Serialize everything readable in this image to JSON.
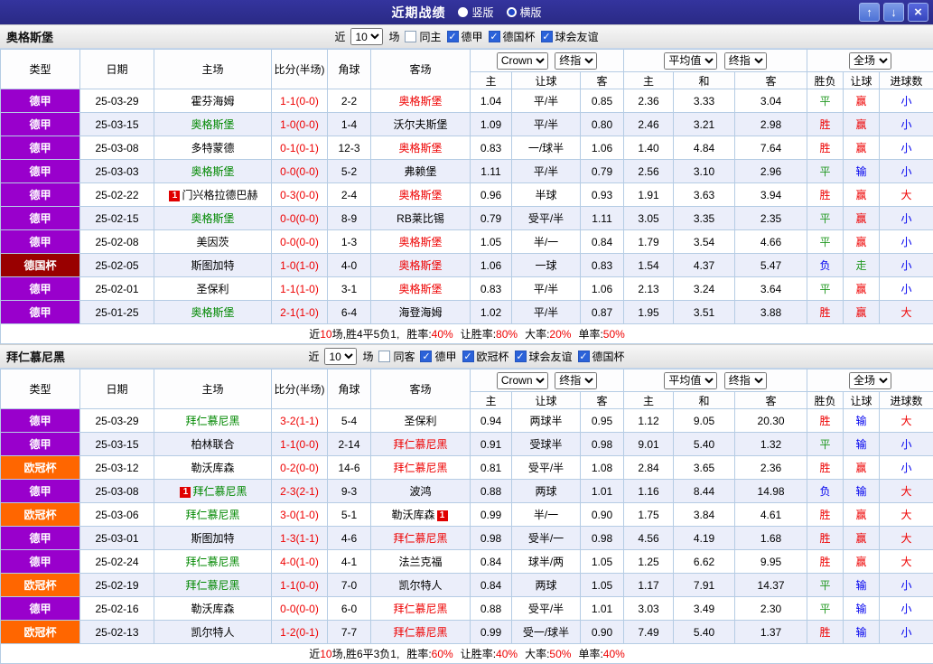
{
  "titlebar": {
    "title": "近期战绩",
    "view_options": [
      {
        "label": "竖版",
        "selected": false
      },
      {
        "label": "横版",
        "selected": true
      }
    ],
    "up_icon": "↑",
    "down_icon": "↓",
    "close_icon": "×"
  },
  "columns": {
    "type": "类型",
    "date": "日期",
    "home": "主场",
    "score": "比分(半场)",
    "corner": "角球",
    "away": "客场",
    "odds_home": "主",
    "odds_line": "让球",
    "odds_away": "客",
    "ep_home": "主",
    "ep_draw": "和",
    "ep_away": "客",
    "result": "胜负",
    "handicap_result": "让球",
    "goals": "进球数"
  },
  "controls": {
    "company": "Crown",
    "final_index": "终指",
    "average": "平均值",
    "final_index2": "终指",
    "full_match": "全场"
  },
  "sections": [
    {
      "team": "奥格斯堡",
      "filter": {
        "recent_label": "近",
        "count": "10",
        "games_label": "场",
        "same_label": "同主",
        "same_checked": false,
        "leagues": [
          {
            "label": "德甲",
            "checked": true
          },
          {
            "label": "德国杯",
            "checked": true
          },
          {
            "label": "球会友谊",
            "checked": true
          }
        ]
      },
      "rows": [
        {
          "league": "德甲",
          "date": "25-03-29",
          "home": "霍芬海姆",
          "score": "1-1(0-0)",
          "corner": "2-2",
          "away": "奥格斯堡",
          "w_home": "1.04",
          "line": "平/半",
          "w_away": "0.85",
          "e_home": "2.36",
          "e_draw": "3.33",
          "e_away": "3.04",
          "result": "平",
          "line_result": "赢",
          "goal_result": "小"
        },
        {
          "league": "德甲",
          "date": "25-03-15",
          "home": "奥格斯堡",
          "score": "1-0(0-0)",
          "corner": "1-4",
          "away": "沃尔夫斯堡",
          "w_home": "1.09",
          "line": "平/半",
          "w_away": "0.80",
          "e_home": "2.46",
          "e_draw": "3.21",
          "e_away": "2.98",
          "result": "胜",
          "line_result": "赢",
          "goal_result": "小"
        },
        {
          "league": "德甲",
          "date": "25-03-08",
          "home": "多特蒙德",
          "score": "0-1(0-1)",
          "corner": "12-3",
          "away": "奥格斯堡",
          "w_home": "0.83",
          "line": "一/球半",
          "w_away": "1.06",
          "e_home": "1.40",
          "e_draw": "4.84",
          "e_away": "7.64",
          "result": "胜",
          "line_result": "赢",
          "goal_result": "小"
        },
        {
          "league": "德甲",
          "date": "25-03-03",
          "home": "奥格斯堡",
          "score": "0-0(0-0)",
          "corner": "5-2",
          "away": "弗赖堡",
          "w_home": "1.11",
          "line": "平/半",
          "w_away": "0.79",
          "e_home": "2.56",
          "e_draw": "3.10",
          "e_away": "2.96",
          "result": "平",
          "line_result": "输",
          "goal_result": "小"
        },
        {
          "league": "德甲",
          "date": "25-02-22",
          "home": "门兴格拉德巴赫",
          "home_card": "1",
          "score": "0-3(0-0)",
          "corner": "2-4",
          "away": "奥格斯堡",
          "w_home": "0.96",
          "line": "半球",
          "w_away": "0.93",
          "e_home": "1.91",
          "e_draw": "3.63",
          "e_away": "3.94",
          "result": "胜",
          "line_result": "赢",
          "goal_result": "大"
        },
        {
          "league": "德甲",
          "date": "25-02-15",
          "home": "奥格斯堡",
          "score": "0-0(0-0)",
          "corner": "8-9",
          "away": "RB莱比锡",
          "w_home": "0.79",
          "line": "受平/半",
          "w_away": "1.11",
          "e_home": "3.05",
          "e_draw": "3.35",
          "e_away": "2.35",
          "result": "平",
          "line_result": "赢",
          "goal_result": "小"
        },
        {
          "league": "德甲",
          "date": "25-02-08",
          "home": "美因茨",
          "score": "0-0(0-0)",
          "corner": "1-3",
          "away": "奥格斯堡",
          "w_home": "1.05",
          "line": "半/一",
          "w_away": "0.84",
          "e_home": "1.79",
          "e_draw": "3.54",
          "e_away": "4.66",
          "result": "平",
          "line_result": "赢",
          "goal_result": "小"
        },
        {
          "league": "德国杯",
          "date": "25-02-05",
          "home": "斯图加特",
          "score": "1-0(1-0)",
          "corner": "4-0",
          "away": "奥格斯堡",
          "w_home": "1.06",
          "line": "一球",
          "w_away": "0.83",
          "e_home": "1.54",
          "e_draw": "4.37",
          "e_away": "5.47",
          "result": "负",
          "line_result": "走",
          "goal_result": "小"
        },
        {
          "league": "德甲",
          "date": "25-02-01",
          "home": "圣保利",
          "score": "1-1(1-0)",
          "corner": "3-1",
          "away": "奥格斯堡",
          "w_home": "0.83",
          "line": "平/半",
          "w_away": "1.06",
          "e_home": "2.13",
          "e_draw": "3.24",
          "e_away": "3.64",
          "result": "平",
          "line_result": "赢",
          "goal_result": "小"
        },
        {
          "league": "德甲",
          "date": "25-01-25",
          "home": "奥格斯堡",
          "score": "2-1(1-0)",
          "corner": "6-4",
          "away": "海登海姆",
          "w_home": "1.02",
          "line": "平/半",
          "w_away": "0.87",
          "e_home": "1.95",
          "e_draw": "3.51",
          "e_away": "3.88",
          "result": "胜",
          "line_result": "赢",
          "goal_result": "大"
        }
      ],
      "summary": {
        "prefix": "近",
        "count": "10",
        "record": "场,胜4平5负1,",
        "stats": [
          {
            "label": "胜率:",
            "value": "40%"
          },
          {
            "label": "让胜率:",
            "value": "80%"
          },
          {
            "label": "大率:",
            "value": "20%"
          },
          {
            "label": "单率:",
            "value": "50%"
          }
        ]
      }
    },
    {
      "team": "拜仁慕尼黑",
      "filter": {
        "recent_label": "近",
        "count": "10",
        "games_label": "场",
        "same_label": "同客",
        "same_checked": false,
        "leagues": [
          {
            "label": "德甲",
            "checked": true
          },
          {
            "label": "欧冠杯",
            "checked": true
          },
          {
            "label": "球会友谊",
            "checked": true
          },
          {
            "label": "德国杯",
            "checked": true
          }
        ]
      },
      "rows": [
        {
          "league": "德甲",
          "date": "25-03-29",
          "home": "拜仁慕尼黑",
          "score": "3-2(1-1)",
          "corner": "5-4",
          "away": "圣保利",
          "w_home": "0.94",
          "line": "两球半",
          "w_away": "0.95",
          "e_home": "1.12",
          "e_draw": "9.05",
          "e_away": "20.30",
          "result": "胜",
          "line_result": "输",
          "goal_result": "大"
        },
        {
          "league": "德甲",
          "date": "25-03-15",
          "home": "柏林联合",
          "score": "1-1(0-0)",
          "corner": "2-14",
          "away": "拜仁慕尼黑",
          "w_home": "0.91",
          "line": "受球半",
          "w_away": "0.98",
          "e_home": "9.01",
          "e_draw": "5.40",
          "e_away": "1.32",
          "result": "平",
          "line_result": "输",
          "goal_result": "小"
        },
        {
          "league": "欧冠杯",
          "date": "25-03-12",
          "home": "勒沃库森",
          "score": "0-2(0-0)",
          "corner": "14-6",
          "away": "拜仁慕尼黑",
          "w_home": "0.81",
          "line": "受平/半",
          "w_away": "1.08",
          "e_home": "2.84",
          "e_draw": "3.65",
          "e_away": "2.36",
          "result": "胜",
          "line_result": "赢",
          "goal_result": "小"
        },
        {
          "league": "德甲",
          "date": "25-03-08",
          "home": "拜仁慕尼黑",
          "home_card": "1",
          "score": "2-3(2-1)",
          "corner": "9-3",
          "away": "波鸿",
          "w_home": "0.88",
          "line": "两球",
          "w_away": "1.01",
          "e_home": "1.16",
          "e_draw": "8.44",
          "e_away": "14.98",
          "result": "负",
          "line_result": "输",
          "goal_result": "大"
        },
        {
          "league": "欧冠杯",
          "date": "25-03-06",
          "home": "拜仁慕尼黑",
          "score": "3-0(1-0)",
          "corner": "5-1",
          "away": "勒沃库森",
          "away_card": "1",
          "w_home": "0.99",
          "line": "半/一",
          "w_away": "0.90",
          "e_home": "1.75",
          "e_draw": "3.84",
          "e_away": "4.61",
          "result": "胜",
          "line_result": "赢",
          "goal_result": "大"
        },
        {
          "league": "德甲",
          "date": "25-03-01",
          "home": "斯图加特",
          "score": "1-3(1-1)",
          "corner": "4-6",
          "away": "拜仁慕尼黑",
          "w_home": "0.98",
          "line": "受半/一",
          "w_away": "0.98",
          "e_home": "4.56",
          "e_draw": "4.19",
          "e_away": "1.68",
          "result": "胜",
          "line_result": "赢",
          "goal_result": "大"
        },
        {
          "league": "德甲",
          "date": "25-02-24",
          "home": "拜仁慕尼黑",
          "score": "4-0(1-0)",
          "corner": "4-1",
          "away": "法兰克福",
          "w_home": "0.84",
          "line": "球半/两",
          "w_away": "1.05",
          "e_home": "1.25",
          "e_draw": "6.62",
          "e_away": "9.95",
          "result": "胜",
          "line_result": "赢",
          "goal_result": "大"
        },
        {
          "league": "欧冠杯",
          "date": "25-02-19",
          "home": "拜仁慕尼黑",
          "score": "1-1(0-0)",
          "corner": "7-0",
          "away": "凯尔特人",
          "w_home": "0.84",
          "line": "两球",
          "w_away": "1.05",
          "e_home": "1.17",
          "e_draw": "7.91",
          "e_away": "14.37",
          "result": "平",
          "line_result": "输",
          "goal_result": "小"
        },
        {
          "league": "德甲",
          "date": "25-02-16",
          "home": "勒沃库森",
          "score": "0-0(0-0)",
          "corner": "6-0",
          "away": "拜仁慕尼黑",
          "w_home": "0.88",
          "line": "受平/半",
          "w_away": "1.01",
          "e_home": "3.03",
          "e_draw": "3.49",
          "e_away": "2.30",
          "result": "平",
          "line_result": "输",
          "goal_result": "小"
        },
        {
          "league": "欧冠杯",
          "date": "25-02-13",
          "home": "凯尔特人",
          "score": "1-2(0-1)",
          "corner": "7-7",
          "away": "拜仁慕尼黑",
          "w_home": "0.99",
          "line": "受一/球半",
          "w_away": "0.90",
          "e_home": "7.49",
          "e_draw": "5.40",
          "e_away": "1.37",
          "result": "胜",
          "line_result": "输",
          "goal_result": "小"
        }
      ],
      "summary": {
        "prefix": "近",
        "count": "10",
        "record": "场,胜6平3负1,",
        "stats": [
          {
            "label": "胜率:",
            "value": "60%"
          },
          {
            "label": "让胜率:",
            "value": "40%"
          },
          {
            "label": "大率:",
            "value": "50%"
          },
          {
            "label": "单率:",
            "value": "40%"
          }
        ]
      }
    }
  ]
}
